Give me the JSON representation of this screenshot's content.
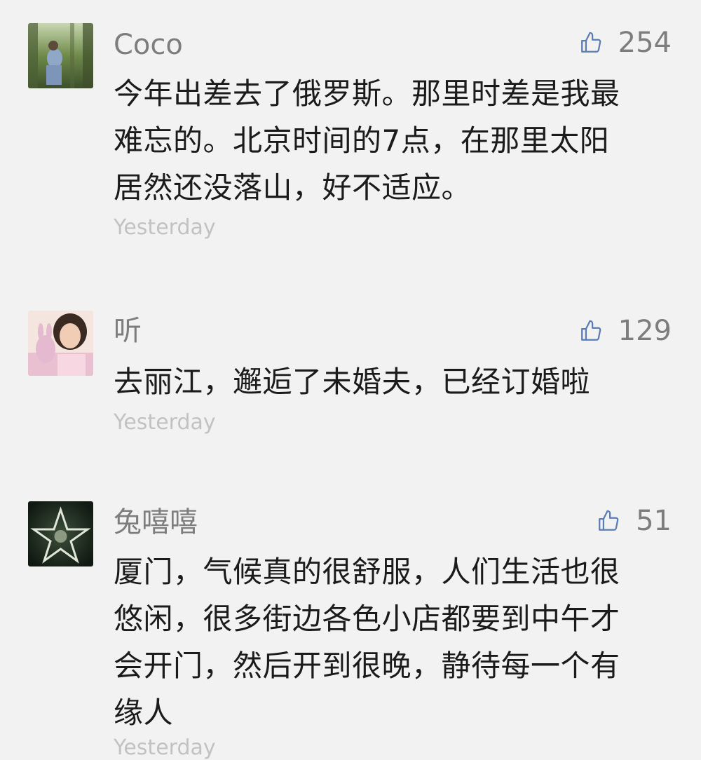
{
  "comments": [
    {
      "name": "Coco",
      "likes": "254",
      "text_lines": [
        "今年出差去了俄罗斯。那里时差是我最",
        "难忘的。北京时间的7点，在那里太阳",
        "居然还没落山，好不适应。"
      ],
      "time": "Yesterday",
      "avatar": "forest-girl-photo"
    },
    {
      "name": "听",
      "likes": "129",
      "text_lines": [
        "去丽江，邂逅了未婚夫，已经订婚啦"
      ],
      "time": "Yesterday",
      "avatar": "girl-with-bunny-photo"
    },
    {
      "name": "兔嘻嘻",
      "likes": "51",
      "text_lines": [
        "厦门，气候真的很舒服，人们生活也很",
        "悠闲，很多街边各色小店都要到中午才",
        "会开门，然后开到很晚，静待每一个有",
        "缘人"
      ],
      "time": "Yesterday",
      "avatar": "pentagram-photo"
    }
  ],
  "icons": {
    "like": "thumbs-up-icon"
  },
  "colors": {
    "background": "#f2f2f2",
    "name": "#7d7d7d",
    "text": "#1b1b1b",
    "time": "#c2c2c2",
    "like_icon": "#5a7db5"
  }
}
